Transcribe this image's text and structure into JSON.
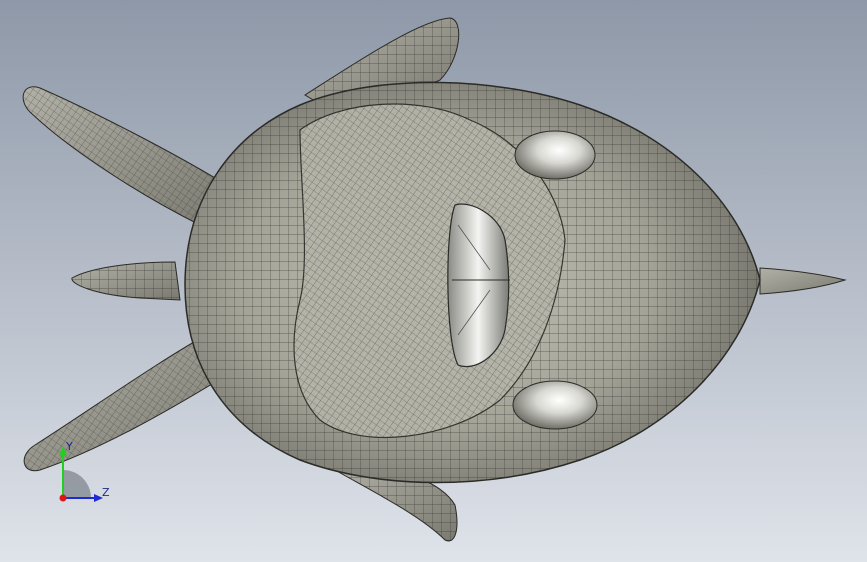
{
  "viewport": {
    "background_top": "#8e98a8",
    "background_bottom": "#dfe3ea",
    "model_fill": "#a6a59a",
    "mesh_color": "#2b2b27",
    "eye_color": "#d9d9d4"
  },
  "triad": {
    "y_axis_label": "Y",
    "z_axis_label": "Z",
    "y_color": "#1fd01f",
    "z_color": "#1e2ad2",
    "x_color": "#e01414",
    "quadrant_color": "#8a8f98"
  }
}
